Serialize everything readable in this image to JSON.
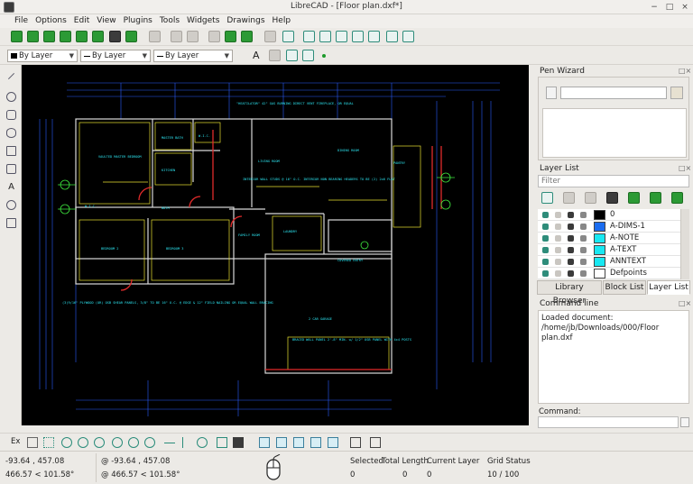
{
  "window": {
    "title": "LibreCAD - [Floor plan.dxf*]"
  },
  "menu": [
    "File",
    "Options",
    "Edit",
    "View",
    "Plugins",
    "Tools",
    "Widgets",
    "Drawings",
    "Help"
  ],
  "props": {
    "color": "By Layer",
    "width": "By Layer",
    "linetype": "By Layer"
  },
  "pen_wizard": {
    "title": "Pen Wizard"
  },
  "layers": {
    "title": "Layer List",
    "filter_placeholder": "Filter",
    "items": [
      {
        "name": "0",
        "color": "#000000"
      },
      {
        "name": "A-DIMS-1",
        "color": "#1a6cf0"
      },
      {
        "name": "A-NOTE",
        "color": "#18e8f2"
      },
      {
        "name": "A-TEXT",
        "color": "#18e8f2"
      },
      {
        "name": "ANNTEXT",
        "color": "#18e8f2"
      },
      {
        "name": "Defpoints",
        "color": "#ffffff"
      }
    ]
  },
  "tabs": [
    "Library Browser",
    "Block List",
    "Layer List"
  ],
  "command_line": {
    "title": "Command line",
    "output": "Loaded document: /home/jb/Downloads/000/Floor plan.dxf",
    "prompt": "Command:"
  },
  "bottom_toolbar": {
    "label": "Ex"
  },
  "status": {
    "abs_coord": "-93.64 , 457.08",
    "abs_polar": "466.57 < 101.58°",
    "rel_coord": "@  -93.64 , 457.08",
    "rel_polar": "@  466.57 < 101.58°",
    "selected_label": "Selected",
    "selected_value": "0",
    "total_length_label": "Total Length",
    "total_length_value": "0",
    "current_layer_label": "Current Layer",
    "current_layer_value": "0",
    "grid_status_label": "Grid Status",
    "grid_status_value": "10 / 100"
  },
  "drawing_text": {
    "heatilator": "\"HEATILATOR\" 42\" GAS BURNING DIRECT VENT FIREPLACE, OR EQUAL",
    "interior_walls": "INTERIOR WALL STUDS @ 16\" O.C. INTERIOR NON BEARING HEADERS TO BE (2) 2x6 FLAT",
    "shear_panels": "(3)9/16\" PLYWOOD (OR) OSB SHEAR PANELS, 3/8\" TO BE 16\" O.C. @ EDGE & 12\" FIELD NAILING OR EQUAL WALL BRACING",
    "braced_wall": "BRACED WALL PANEL 2'-8\" MIN. w/ 1/2\" OSB PANEL WITH 4x4 POSTS",
    "rooms": [
      "VAULTED MASTER BEDROOM",
      "MASTER BATH",
      "W.I.C.",
      "LIVING ROOM",
      "DINING ROOM",
      "KITCHEN",
      "FAMILY ROOM",
      "BEDROOM 2",
      "BEDROOM 3",
      "W.I.C.",
      "BATH",
      "LAUNDRY",
      "2 CAR GARAGE",
      "PANTRY",
      "COVERED ENTRY"
    ]
  }
}
